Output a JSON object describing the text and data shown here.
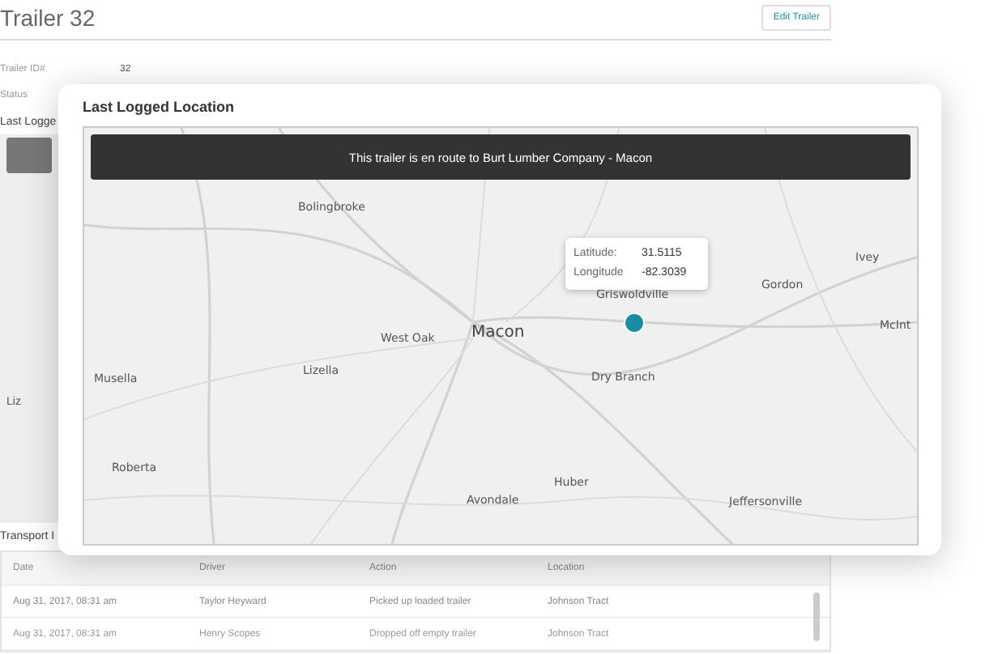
{
  "page": {
    "title": "Trailer 32",
    "edit_button": "Edit Trailer",
    "fields": [
      {
        "label": "Trailer ID#",
        "value": "32"
      },
      {
        "label": "Status"
      }
    ],
    "location_heading": "Last Logge",
    "background_map_labels": [
      "Liz"
    ],
    "transport_heading": "Transport I",
    "table": {
      "columns": [
        "Date",
        "Driver",
        "Action",
        "Location"
      ],
      "rows": [
        [
          "Aug 31, 2017, 08:31 am",
          "Taylor Heyward",
          "Picked up loaded trailer",
          "Johnson Tract"
        ],
        [
          "Aug 31, 2017, 08:31 am",
          "Henry Scopes",
          "Dropped off empty trailer",
          "Johnson Tract"
        ]
      ]
    }
  },
  "modal": {
    "title": "Last Logged Location",
    "banner": "This trailer is en route to Burt Lumber Company - Macon",
    "map_labels": [
      "Bolingbroke",
      "Ivey",
      "Gordon",
      "Griswoldville",
      "McInt",
      "West Oak",
      "Macon",
      "Lizella",
      "Musella",
      "Dry Branch",
      "Roberta",
      "Huber",
      "Avondale",
      "Jeffersonville"
    ],
    "tooltip": [
      {
        "label": "Latitude:",
        "value": "31.5115"
      },
      {
        "label": "Longitude",
        "value": "-82.3039"
      }
    ]
  }
}
